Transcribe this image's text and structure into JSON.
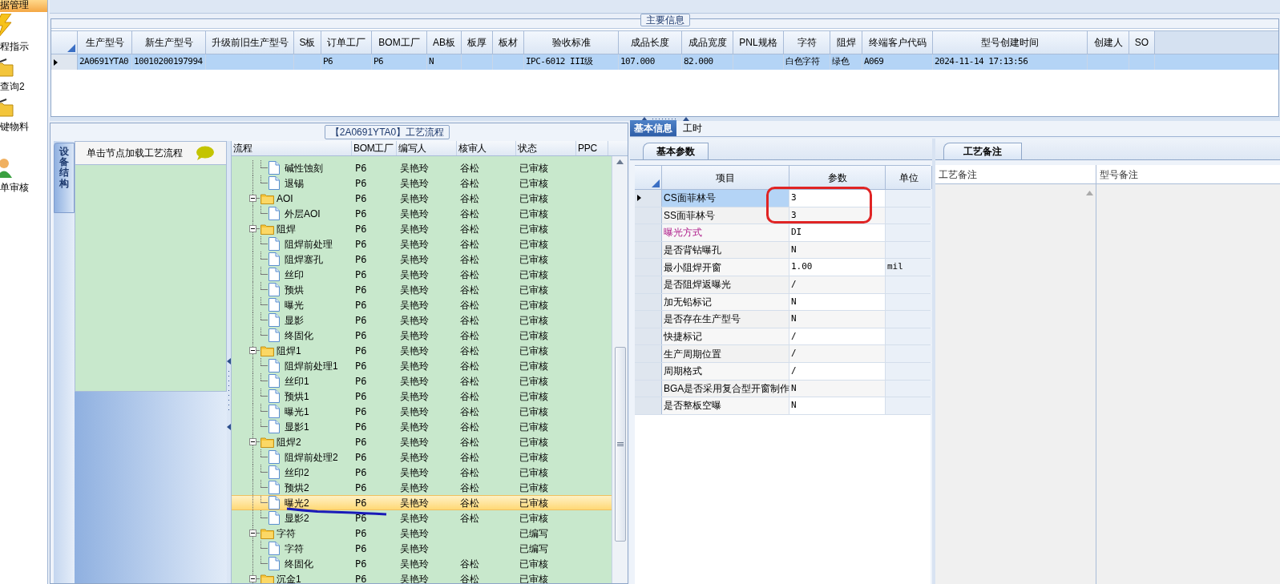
{
  "sidebar": {
    "header": "据管理",
    "items": [
      {
        "label": "程指示"
      },
      {
        "label": "查询2"
      },
      {
        "label": "键物料"
      },
      {
        "label": "单审核"
      }
    ]
  },
  "main_info": {
    "title": "主要信息",
    "columns": [
      "生产型号",
      "新生产型号",
      "升级前旧生产型号",
      "S板",
      "订单工厂",
      "BOM工厂",
      "AB板",
      "板厚",
      "板材",
      "验收标准",
      "成品长度",
      "成品宽度",
      "PNL规格",
      "字符",
      "阻焊",
      "终端客户代码",
      "型号创建时间",
      "创建人",
      "SO"
    ],
    "rows": [
      {
        "selected": true,
        "cells": [
          "2A0691YTA0",
          "10010200197994",
          "",
          "",
          "P6",
          "P6",
          "N",
          "",
          "",
          "IPC-6012 III级",
          "107.000",
          "82.000",
          "",
          "白色字符",
          "绿色",
          "A069",
          "2024-11-14 17:13:56",
          "",
          ""
        ]
      }
    ]
  },
  "process_panel": {
    "title": "【2A0691YTA0】工艺流程",
    "side_tab": "设备结构",
    "hint": "单击节点加载工艺流程",
    "columns": [
      "流程",
      "BOM工厂",
      "编写人",
      "核审人",
      "状态",
      "PPC"
    ],
    "nodes": [
      {
        "children": [
          {
            "label": "碱性蚀刻",
            "bom": "P6",
            "writer": "吴艳玲",
            "reviewer": "谷松",
            "status": "已审核",
            "selected": false
          },
          {
            "label": "退锡",
            "bom": "P6",
            "writer": "吴艳玲",
            "reviewer": "谷松",
            "status": "已审核",
            "selected": false
          }
        ]
      },
      {
        "label": "AOI",
        "bom": "P6",
        "writer": "吴艳玲",
        "reviewer": "谷松",
        "status": "已审核",
        "selected": false,
        "expanded": true,
        "children": [
          {
            "label": "外层AOI",
            "bom": "P6",
            "writer": "吴艳玲",
            "reviewer": "谷松",
            "status": "已审核",
            "selected": false
          }
        ]
      },
      {
        "label": "阻焊",
        "bom": "P6",
        "writer": "吴艳玲",
        "reviewer": "谷松",
        "status": "已审核",
        "selected": false,
        "expanded": true,
        "children": [
          {
            "label": "阻焊前处理",
            "bom": "P6",
            "writer": "吴艳玲",
            "reviewer": "谷松",
            "status": "已审核",
            "selected": false
          },
          {
            "label": "阻焊塞孔",
            "bom": "P6",
            "writer": "吴艳玲",
            "reviewer": "谷松",
            "status": "已审核",
            "selected": false
          },
          {
            "label": "丝印",
            "bom": "P6",
            "writer": "吴艳玲",
            "reviewer": "谷松",
            "status": "已审核",
            "selected": false
          },
          {
            "label": "预烘",
            "bom": "P6",
            "writer": "吴艳玲",
            "reviewer": "谷松",
            "status": "已审核",
            "selected": false
          },
          {
            "label": "曝光",
            "bom": "P6",
            "writer": "吴艳玲",
            "reviewer": "谷松",
            "status": "已审核",
            "selected": false
          },
          {
            "label": "显影",
            "bom": "P6",
            "writer": "吴艳玲",
            "reviewer": "谷松",
            "status": "已审核",
            "selected": false
          },
          {
            "label": "终固化",
            "bom": "P6",
            "writer": "吴艳玲",
            "reviewer": "谷松",
            "status": "已审核",
            "selected": false
          }
        ]
      },
      {
        "label": "阻焊1",
        "bom": "P6",
        "writer": "吴艳玲",
        "reviewer": "谷松",
        "status": "已审核",
        "selected": false,
        "expanded": true,
        "children": [
          {
            "label": "阻焊前处理1",
            "bom": "P6",
            "writer": "吴艳玲",
            "reviewer": "谷松",
            "status": "已审核",
            "selected": false
          },
          {
            "label": "丝印1",
            "bom": "P6",
            "writer": "吴艳玲",
            "reviewer": "谷松",
            "status": "已审核",
            "selected": false
          },
          {
            "label": "预烘1",
            "bom": "P6",
            "writer": "吴艳玲",
            "reviewer": "谷松",
            "status": "已审核",
            "selected": false
          },
          {
            "label": "曝光1",
            "bom": "P6",
            "writer": "吴艳玲",
            "reviewer": "谷松",
            "status": "已审核",
            "selected": false
          },
          {
            "label": "显影1",
            "bom": "P6",
            "writer": "吴艳玲",
            "reviewer": "谷松",
            "status": "已审核",
            "selected": false
          }
        ]
      },
      {
        "label": "阻焊2",
        "bom": "P6",
        "writer": "吴艳玲",
        "reviewer": "谷松",
        "status": "已审核",
        "selected": false,
        "expanded": true,
        "children": [
          {
            "label": "阻焊前处理2",
            "bom": "P6",
            "writer": "吴艳玲",
            "reviewer": "谷松",
            "status": "已审核",
            "selected": false
          },
          {
            "label": "丝印2",
            "bom": "P6",
            "writer": "吴艳玲",
            "reviewer": "谷松",
            "status": "已审核",
            "selected": false
          },
          {
            "label": "预烘2",
            "bom": "P6",
            "writer": "吴艳玲",
            "reviewer": "谷松",
            "status": "已审核",
            "selected": false
          },
          {
            "label": "曝光2",
            "bom": "P6",
            "writer": "吴艳玲",
            "reviewer": "谷松",
            "status": "已审核",
            "selected": true
          },
          {
            "label": "显影2",
            "bom": "P6",
            "writer": "吴艳玲",
            "reviewer": "谷松",
            "status": "已审核",
            "selected": false
          }
        ]
      },
      {
        "label": "字符",
        "bom": "P6",
        "writer": "吴艳玲",
        "status": "已编写",
        "selected": false,
        "expanded": true,
        "children": [
          {
            "label": "字符",
            "bom": "P6",
            "writer": "吴艳玲",
            "status": "已编写",
            "selected": false
          },
          {
            "label": "终固化",
            "bom": "P6",
            "writer": "吴艳玲",
            "reviewer": "谷松",
            "status": "已审核",
            "selected": false
          }
        ]
      },
      {
        "label": "沉金1",
        "bom": "P6",
        "writer": "吴艳玲",
        "reviewer": "谷松",
        "status": "已审核",
        "selected": false,
        "expanded": true
      }
    ]
  },
  "detail_tabs": [
    {
      "label": "基本信息",
      "selected": true
    },
    {
      "label": "工时",
      "selected": false
    }
  ],
  "params": {
    "tab": "基本参数",
    "columns": [
      "项目",
      "参数",
      "单位"
    ],
    "rows": [
      {
        "item": "CS面菲林号",
        "value": "3",
        "selected": true,
        "highlighted": false
      },
      {
        "item": "SS面菲林号",
        "value": "3",
        "selected": false,
        "highlighted": false
      },
      {
        "item": "曝光方式",
        "value": "DI",
        "selected": false,
        "highlighted": true
      },
      {
        "item": "是否背钻曝孔",
        "value": "N",
        "selected": false,
        "highlighted": false
      },
      {
        "item": "最小阻焊开窗",
        "value": "1.00",
        "unit": "mil",
        "selected": false,
        "highlighted": false
      },
      {
        "item": "是否阻焊返曝光",
        "value": "/",
        "selected": false,
        "highlighted": false
      },
      {
        "item": "加无铅标记",
        "value": "N",
        "selected": false,
        "highlighted": false
      },
      {
        "item": "是否存在生产型号",
        "value": "N",
        "selected": false,
        "highlighted": false
      },
      {
        "item": "快捷标记",
        "value": "/",
        "selected": false,
        "highlighted": false
      },
      {
        "item": "生产周期位置",
        "value": "/",
        "selected": false,
        "highlighted": false
      },
      {
        "item": "周期格式",
        "value": "/",
        "selected": false,
        "highlighted": false
      },
      {
        "item": "BGA是否采用复合型开窗制作",
        "value": "N",
        "selected": false,
        "highlighted": false
      },
      {
        "item": "是否整板空曝",
        "value": "N",
        "selected": false,
        "highlighted": false
      }
    ]
  },
  "notes": {
    "tab": "工艺备注",
    "columns": [
      "工艺备注",
      "型号备注"
    ]
  },
  "markup": [
    {
      "kind": "outline",
      "color": "#e02424"
    },
    {
      "kind": "stroke",
      "color": "#1a1ab8"
    }
  ]
}
